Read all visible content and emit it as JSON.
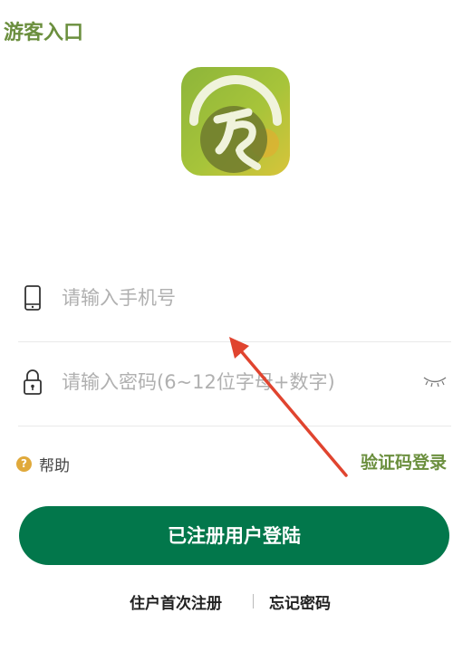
{
  "guest_entry": "游客入口",
  "logo": {
    "icon": "app-logo-icon",
    "colors": [
      "#8db53a",
      "#d8c43a",
      "#f0f3dc",
      "#6e7a2e"
    ]
  },
  "phone_field": {
    "icon": "phone-icon",
    "placeholder": "请输入手机号",
    "value": ""
  },
  "password_field": {
    "icon": "lock-icon",
    "placeholder": "请输入密码(6~12位字母+数字)",
    "value": "",
    "toggle_icon": "eye-closed-icon"
  },
  "help": {
    "icon": "question-icon",
    "label": "帮助"
  },
  "sms_login": "验证码登录",
  "login_button": "已注册用户登陆",
  "bottom": {
    "register": "住户首次注册",
    "forgot": "忘记密码"
  },
  "annotation": {
    "icon": "red-arrow-icon",
    "color": "#e0442f"
  },
  "colors": {
    "primary": "#02774b",
    "accent_green": "#6b8f3e",
    "help_orange": "#e0a93b"
  }
}
